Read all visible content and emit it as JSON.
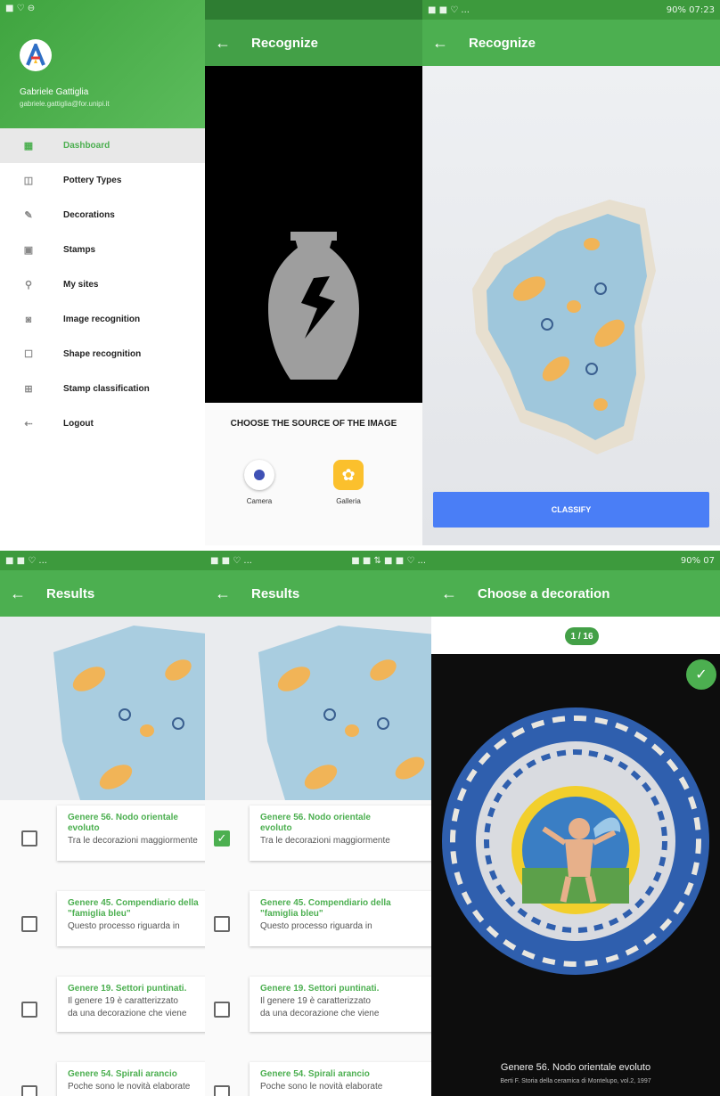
{
  "drawer": {
    "user_name": "Gabriele Gattiglia",
    "user_email": "gabriele.gattiglia@for.unipi.it",
    "items": [
      {
        "label": "Dashboard"
      },
      {
        "label": "Pottery Types"
      },
      {
        "label": "Decorations"
      },
      {
        "label": "Stamps"
      },
      {
        "label": "My sites"
      },
      {
        "label": "Image recognition"
      },
      {
        "label": "Shape recognition"
      },
      {
        "label": "Stamp classification"
      },
      {
        "label": "Logout"
      }
    ]
  },
  "recognize_source": {
    "title": "Recognize",
    "choose_label": "CHOOSE THE SOURCE OF THE IMAGE",
    "camera_label": "Camera",
    "gallery_label": "Galleria"
  },
  "recognize_photo": {
    "status_right": "90% 07:23",
    "title": "Recognize",
    "classify_label": "CLASSIFY"
  },
  "results": {
    "title": "Results",
    "items": [
      {
        "title": "Genere 56. Nodo orientale",
        "title2": "evoluto",
        "desc": "Tra le decorazioni maggiormente",
        "checked": false
      },
      {
        "title": "Genere 45. Compendiario della",
        "title2": "\"famiglia bleu\"",
        "desc": "Questo processo riguarda in",
        "checked": false
      },
      {
        "title": "Genere 19. Settori puntinati.",
        "title2": "",
        "desc": "Il genere 19 è caratterizzato",
        "desc2": "da una decorazione che viene",
        "checked": false
      },
      {
        "title": "Genere 54. Spirali arancio",
        "title2": "",
        "desc": "Poche sono le novità elaborate",
        "checked": false
      }
    ],
    "items_b": [
      {
        "title": "Genere 56. Nodo orientale",
        "title2": "evoluto",
        "desc": "Tra le decorazioni maggiormente",
        "checked": true
      },
      {
        "title": "Genere 45. Compendiario della",
        "title2": "\"famiglia bleu\"",
        "desc": "Questo processo riguarda in",
        "checked": false
      },
      {
        "title": "Genere 19. Settori puntinati.",
        "title2": "",
        "desc": "Il genere 19 è caratterizzato",
        "desc2": "da una decorazione che viene",
        "checked": false
      },
      {
        "title": "Genere 54. Spirali arancio",
        "title2": "",
        "desc": "Poche sono le novità elaborate",
        "checked": false
      }
    ]
  },
  "decoration": {
    "title": "Choose a decoration",
    "status_right": "90% 07",
    "counter": "1 / 16",
    "caption": "Genere 56. Nodo orientale evoluto",
    "caption_ref": "Berti F. Storia della ceramica di Montelupo, vol.2, 1997"
  },
  "colors": {
    "primary": "#4caf50",
    "accent": "#4a7ef6"
  }
}
